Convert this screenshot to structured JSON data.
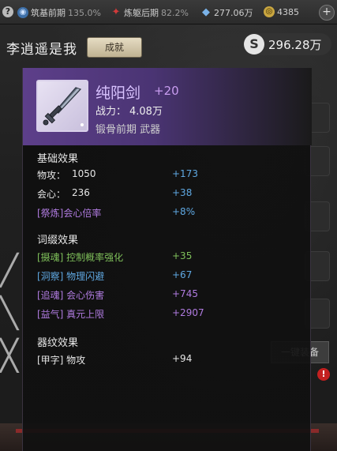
{
  "topbar": {
    "help_icon": "?",
    "stats": [
      {
        "name": "筑基前期",
        "value": "135.0%",
        "icon": "realm-orb-icon"
      },
      {
        "name": "炼躯后期",
        "value": "82.2%",
        "icon": "body-rune-icon"
      },
      {
        "name": "277.06万",
        "value": "",
        "icon": "spirit-stone-icon"
      },
      {
        "name": "4385",
        "value": "",
        "icon": "jade-coin-icon"
      }
    ],
    "plus_label": "+"
  },
  "header": {
    "player_name": "李逍遥是我",
    "achievement_label": "成就",
    "currency_symbol": "S",
    "currency_amount": "296.28万"
  },
  "background": {
    "equip_all_label": "一键装备",
    "notification_badge": "!"
  },
  "item": {
    "name": "纯阳剑",
    "enhance": "+20",
    "power_label": "战力：",
    "power_value": "4.08万",
    "realm_type": "锻骨前期 武器",
    "icon": "sword-icon"
  },
  "sections": {
    "basic": {
      "title": "基础效果",
      "rows": [
        {
          "label": "物攻：",
          "value": "1050",
          "bonus": "+173"
        },
        {
          "label": "会心：",
          "value": "236",
          "bonus": "+38"
        },
        {
          "label": "[祭炼]会心倍率",
          "value": "",
          "bonus": "+8%"
        }
      ]
    },
    "affix": {
      "title": "词缀效果",
      "rows": [
        {
          "label": "[摄魂] 控制概率强化",
          "bonus": "+35"
        },
        {
          "label": "[洞察] 物理闪避",
          "bonus": "+67"
        },
        {
          "label": "[追魂] 会心伤害",
          "bonus": "+745"
        },
        {
          "label": "[益气] 真元上限",
          "bonus": "+2907"
        }
      ]
    },
    "pattern": {
      "title": "器纹效果",
      "rows": [
        {
          "label": "[甲字] 物攻",
          "bonus": "+94"
        }
      ]
    }
  },
  "colors": {
    "rarity_purple": "#5d3f8a",
    "bonus_blue": "#5fa8e2",
    "affix_green": "#7fc05a",
    "affix_purple": "#b07be0"
  }
}
